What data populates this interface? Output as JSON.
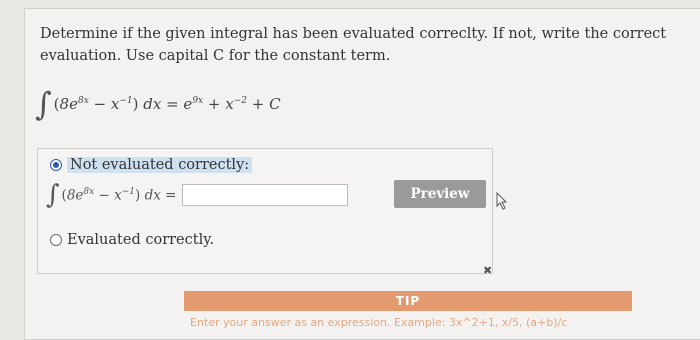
{
  "question": {
    "text": "Determine if the given integral has been evaluated correclty. If not, write the correct evaluation. Use capital C for the constant term."
  },
  "formula": {
    "lhs_coef": "8",
    "lhs_exp": "8x",
    "rhs_exp": "9x",
    "pow": "−1",
    "pow2": "−2",
    "text_rhs": "+ C"
  },
  "options": {
    "not_correct": "Not evaluated correctly:",
    "correct": "Evaluated correctly."
  },
  "answer": {
    "input_value": "",
    "preview_label": "Preview"
  },
  "icons": {
    "cursor": "cursor-icon",
    "close": "close-icon"
  },
  "tip": {
    "title": "TIP",
    "text": "Enter your answer as an expression. Example: 3x^2+1, x/5, (a+b)/c"
  }
}
